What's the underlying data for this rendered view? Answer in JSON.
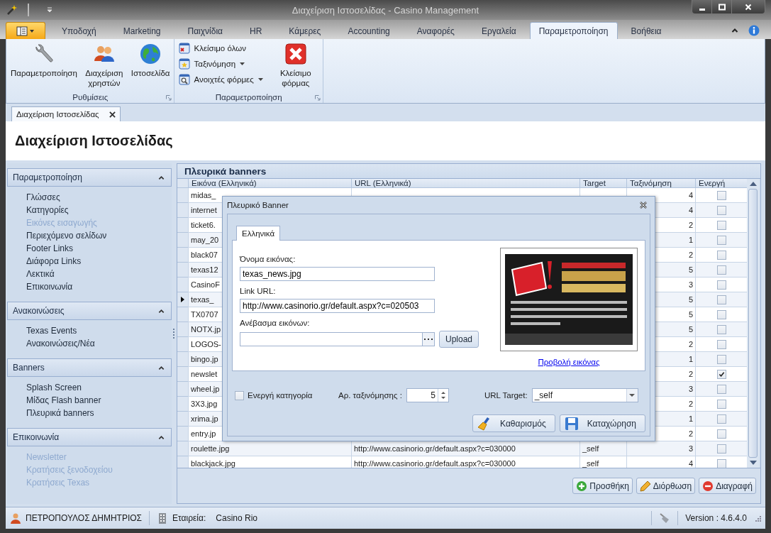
{
  "window": {
    "title": "Διαχείριση Ιστοσελίδας - Casino Management"
  },
  "ribbon": {
    "tabs": [
      {
        "label": "Υποδοχή",
        "selected": false
      },
      {
        "label": "Marketing",
        "selected": false
      },
      {
        "label": "Παιχνίδια",
        "selected": false
      },
      {
        "label": "HR",
        "selected": false
      },
      {
        "label": "Κάμερες",
        "selected": false
      },
      {
        "label": "Accounting",
        "selected": false
      },
      {
        "label": "Αναφορές",
        "selected": false
      },
      {
        "label": "Εργαλεία",
        "selected": false
      },
      {
        "label": "Παραμετροποίηση",
        "selected": true
      },
      {
        "label": "Βοήθεια",
        "selected": false
      }
    ],
    "groups": [
      {
        "title": "Ρυθμίσεις",
        "buttons": [
          {
            "kind": "large",
            "label": "Παραμετροποίηση",
            "dropdown": false
          },
          {
            "kind": "large",
            "label": "Διαχείριση χρηστών",
            "dropdown": false
          },
          {
            "kind": "large",
            "label": "Ιστοσελίδα",
            "dropdown": false
          }
        ]
      },
      {
        "title": "Παραμετροποίηση",
        "buttons": [
          {
            "kind": "small",
            "label": "Κλείσιμο όλων",
            "dropdown": false
          },
          {
            "kind": "small",
            "label": "Ταξινόμηση",
            "dropdown": true
          },
          {
            "kind": "small",
            "label": "Ανοιχτές φόρμες",
            "dropdown": true
          },
          {
            "kind": "large",
            "label": "Κλείσιμο φόρμας",
            "dropdown": false
          }
        ]
      }
    ]
  },
  "document_tabs": [
    {
      "label": "Διαχείριση Ιστοσελίδας",
      "selected": true
    }
  ],
  "page_title": "Διαχείριση Ιστοσελίδας",
  "sidebar": {
    "groups": [
      {
        "title": "Παραμετροποίηση",
        "expanded": true,
        "items": [
          {
            "label": "Γλώσσες",
            "disabled": false
          },
          {
            "label": "Κατηγορίες",
            "disabled": false
          },
          {
            "label": "Εικόνες εισαγωγής",
            "disabled": true
          },
          {
            "label": "Περιεχόμενο σελίδων",
            "disabled": false
          },
          {
            "label": "Footer Links",
            "disabled": false
          },
          {
            "label": "Διάφορα Links",
            "disabled": false
          },
          {
            "label": "Λεκτικά",
            "disabled": false
          },
          {
            "label": "Επικοινωνία",
            "disabled": false
          }
        ]
      },
      {
        "title": "Ανακοινώσεις",
        "expanded": true,
        "items": [
          {
            "label": "Texas Events",
            "disabled": false
          },
          {
            "label": "Ανακοινώσεις/Νέα",
            "disabled": false
          }
        ]
      },
      {
        "title": "Banners",
        "expanded": true,
        "items": [
          {
            "label": "Splash Screen",
            "disabled": false
          },
          {
            "label": "Μίδας Flash banner",
            "disabled": false
          },
          {
            "label": "Πλευρικά banners",
            "disabled": false
          }
        ]
      },
      {
        "title": "Επικοινωνία",
        "expanded": true,
        "items": [
          {
            "label": "Newsletter",
            "disabled": true
          },
          {
            "label": "Κρατήσεις ξενοδοχείου",
            "disabled": true
          },
          {
            "label": "Κρατήσεις Texas",
            "disabled": true
          }
        ]
      }
    ]
  },
  "grid": {
    "title": "Πλευρικά banners",
    "columns": [
      "Εικόνα (Ελληνικά)",
      "URL (Ελληνικά)",
      "Target",
      "Ταξινόμηση",
      "Ενεργή"
    ],
    "rows": [
      {
        "image": "midas_",
        "sort": "4",
        "active": false,
        "current": false
      },
      {
        "image": "internet",
        "sort": "4",
        "active": false,
        "current": false
      },
      {
        "image": "ticket6.",
        "sort": "2",
        "active": false,
        "current": false
      },
      {
        "image": "may_20",
        "sort": "1",
        "active": false,
        "current": false
      },
      {
        "image": "black07",
        "sort": "2",
        "active": false,
        "current": false
      },
      {
        "image": "texas12",
        "sort": "5",
        "active": false,
        "current": false
      },
      {
        "image": "CasinoF",
        "sort": "3",
        "active": false,
        "current": false
      },
      {
        "image": "texas_",
        "sort": "5",
        "active": false,
        "current": true
      },
      {
        "image": "TX0707",
        "sort": "5",
        "active": false,
        "current": false
      },
      {
        "image": "NOTX.jp",
        "sort": "5",
        "active": false,
        "current": false
      },
      {
        "image": "LOGOS-",
        "sort": "2",
        "active": false,
        "current": false
      },
      {
        "image": "bingo.jp",
        "sort": "1",
        "active": false,
        "current": false
      },
      {
        "image": "newslet",
        "sort": "2",
        "active": true,
        "current": false
      },
      {
        "image": "wheel.jp",
        "sort": "3",
        "active": false,
        "current": false
      },
      {
        "image": "3X3.jpg",
        "sort": "2",
        "active": false,
        "current": false
      },
      {
        "image": "xrima.jp",
        "sort": "1",
        "active": false,
        "current": false
      },
      {
        "image": "entry.jp",
        "sort": "2",
        "active": false,
        "current": false
      },
      {
        "image": "roulette.jpg",
        "url": "http://www.casinorio.gr/default.aspx?c=030000",
        "target": "_self",
        "sort": "3",
        "active": false,
        "current": false
      },
      {
        "image": "blackjack.jpg",
        "url": "http://www.casinorio.gr/default.aspx?c=030000",
        "target": "_self",
        "sort": "4",
        "active": false,
        "current": false
      }
    ],
    "buttons": [
      "Προσθήκη",
      "Διόρθωση",
      "Διαγραφή"
    ]
  },
  "dialog": {
    "title": "Πλευρικό Banner",
    "tabs": [
      {
        "label": "Ελληνικά",
        "selected": true
      }
    ],
    "image_name": {
      "label": "Όνομα εικόνας:",
      "value": "texas_news.jpg"
    },
    "link_url": {
      "label": "Link URL:",
      "value": "http://www.casinorio.gr/default.aspx?c=020503"
    },
    "upload": {
      "label": "Ανέβασμα εικόνων:",
      "button": "Upload"
    },
    "preview": {
      "kind": "picture",
      "link": "Προβολή εικόνας"
    },
    "active_category": {
      "label": "Ενεργή κατηγορία",
      "checked": false
    },
    "sort_order": {
      "label": "Αρ. ταξινόμησης :",
      "value": "5"
    },
    "url_target": {
      "label": "URL Target:",
      "value": "_self"
    },
    "buttons": [
      "Καθαρισμός",
      "Καταχώρηση"
    ]
  },
  "status_bar": {
    "user": "ΠΕΤΡΟΠΟΥΛΟΣ ΔΗΜΗΤΡΙΟΣ",
    "company_label": "Εταιρεία:",
    "company": "Casino Rio",
    "version": "Version : 4.6.4.0"
  }
}
